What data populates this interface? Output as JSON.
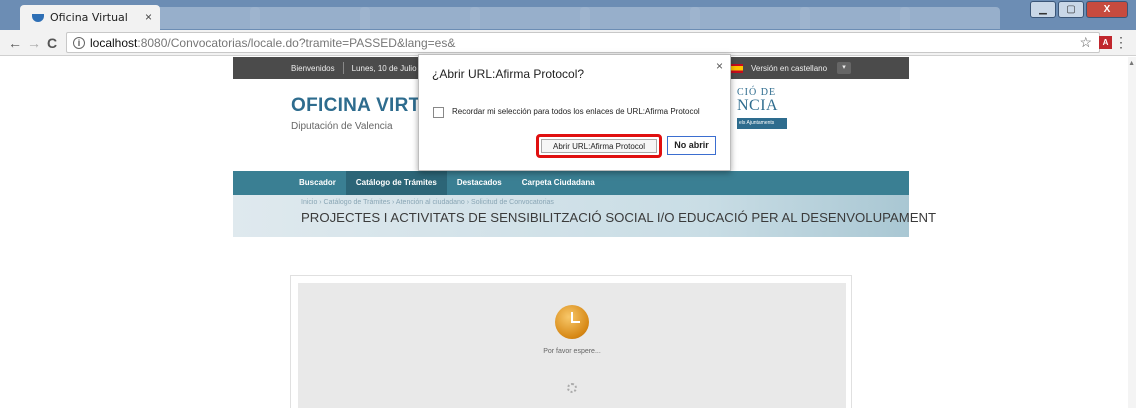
{
  "browser": {
    "tab_title": "Oficina Virtual",
    "tab_close": "×",
    "url_host": "localhost",
    "url_path": ":8080/Convocatorias/locale.do?tramite=PASSED&lang=es&",
    "info": "i",
    "back": "←",
    "forward": "→",
    "reload": "C",
    "star": "☆",
    "pdf": "A",
    "menu": "⋮",
    "win_min": "▁",
    "win_max": "▢",
    "win_close": "X"
  },
  "site": {
    "topbar": {
      "welcome": "Bienvenidos",
      "date": "Lunes, 10 de Julio de",
      "language": "Versión en castellano",
      "caret": "▾"
    },
    "brand": {
      "title": "OFICINA VIRT",
      "subtitle": "Diputación de Valencia"
    },
    "logo": {
      "line1": "CIÓ DE",
      "line2": "NCIA",
      "line3": "els Ajuntaments"
    },
    "nav": [
      {
        "label": "Buscador"
      },
      {
        "label": "Catálogo de Trámites"
      },
      {
        "label": "Destacados"
      },
      {
        "label": "Carpeta Ciudadana"
      }
    ],
    "breadcrumb": "Inicio  ›  Catálogo de Trámites  ›  Atención al ciudadano  ›  Solicitud de Convocatorias",
    "page_title": "PROJECTES I ACTIVITATS DE SENSIBILITZACIÓ SOCIAL I/O EDUCACIÓ PER AL DESENVOLUPAMENT",
    "wait_text": "Por favor espere..."
  },
  "dialog": {
    "title": "¿Abrir URL:Afirma Protocol?",
    "close": "×",
    "checkbox_label": "Recordar mi selección para todos los enlaces de URL:Afirma Protocol",
    "open_button": "Abrir URL:Afirma Protocol",
    "cancel_button": "No abrir"
  },
  "colors": {
    "highlight": "#e01010",
    "nav_bar": "#3a7f93",
    "brand": "#2e6c8e"
  }
}
